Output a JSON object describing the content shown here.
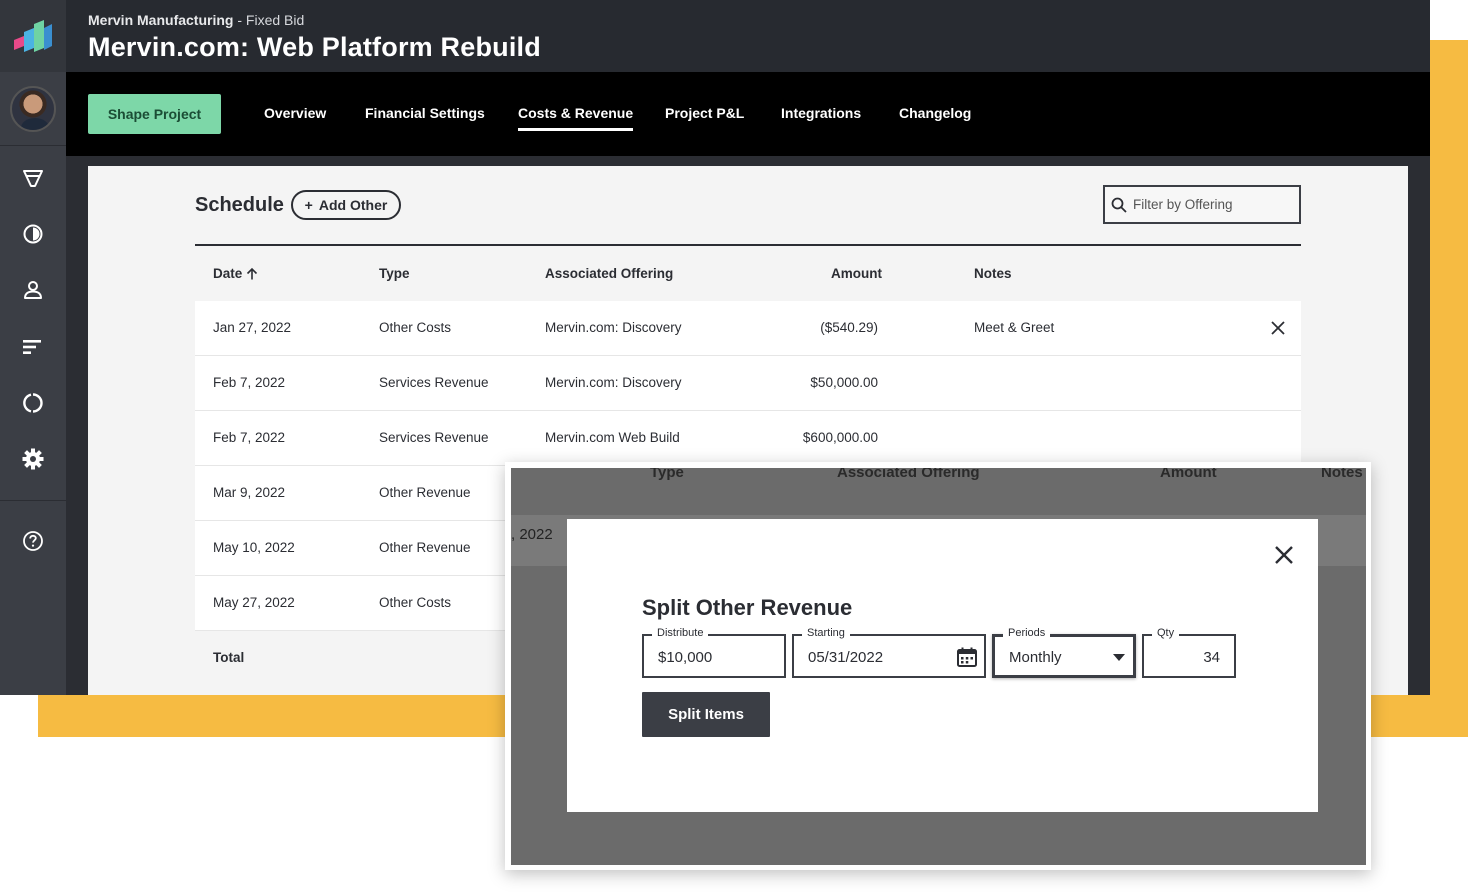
{
  "header": {
    "client": "Mervin Manufacturing",
    "billing_type": "Fixed Bid",
    "project_title": "Mervin.com: Web Platform Rebuild"
  },
  "sidebar": {
    "icons": [
      "logo-icon",
      "funnel-icon",
      "timer-icon",
      "user-icon",
      "bars-icon",
      "cycle-icon",
      "gear-icon",
      "help-icon"
    ]
  },
  "nav": {
    "shape_button": "Shape Project",
    "tabs": [
      "Overview",
      "Financial Settings",
      "Costs & Revenue",
      "Project P&L",
      "Integrations",
      "Changelog"
    ],
    "active_tab": "Costs & Revenue"
  },
  "schedule": {
    "title": "Schedule",
    "add_button": "Add Other",
    "filter_placeholder": "Filter by Offering",
    "columns": [
      "Date",
      "Type",
      "Associated Offering",
      "Amount",
      "Notes"
    ],
    "rows": [
      {
        "date": "Jan 27, 2022",
        "type": "Other Costs",
        "offering": "Mervin.com: Discovery",
        "amount": "($540.29)",
        "notes": "Meet & Greet"
      },
      {
        "date": "Feb 7, 2022",
        "type": "Services Revenue",
        "offering": "Mervin.com: Discovery",
        "amount": "$50,000.00",
        "notes": ""
      },
      {
        "date": "Feb 7, 2022",
        "type": "Services Revenue",
        "offering": "Mervin.com Web Build",
        "amount": "$600,000.00",
        "notes": ""
      },
      {
        "date": "Mar 9, 2022",
        "type": "Other Revenue",
        "offering": "",
        "amount": "",
        "notes": ""
      },
      {
        "date": "May 10, 2022",
        "type": "Other Revenue",
        "offering": "",
        "amount": "",
        "notes": ""
      },
      {
        "date": "May 27, 2022",
        "type": "Other Costs",
        "offering": "",
        "amount": "",
        "notes": ""
      }
    ],
    "total_label": "Total"
  },
  "overlay": {
    "ghost_columns": [
      "Type",
      "Associated Offering",
      "Amount",
      "Notes"
    ],
    "ghost_date": ", 2022"
  },
  "modal": {
    "title": "Split Other Revenue",
    "distribute_label": "Distribute",
    "distribute_value": "$10,000",
    "starting_label": "Starting",
    "starting_value": "05/31/2022",
    "periods_label": "Periods",
    "periods_value": "Monthly",
    "qty_label": "Qty",
    "qty_value": "34",
    "split_button": "Split Items"
  },
  "colors": {
    "accent_green": "#7dd7a8",
    "frame_yellow": "#f6bb42",
    "dark": "#2b2d33"
  }
}
